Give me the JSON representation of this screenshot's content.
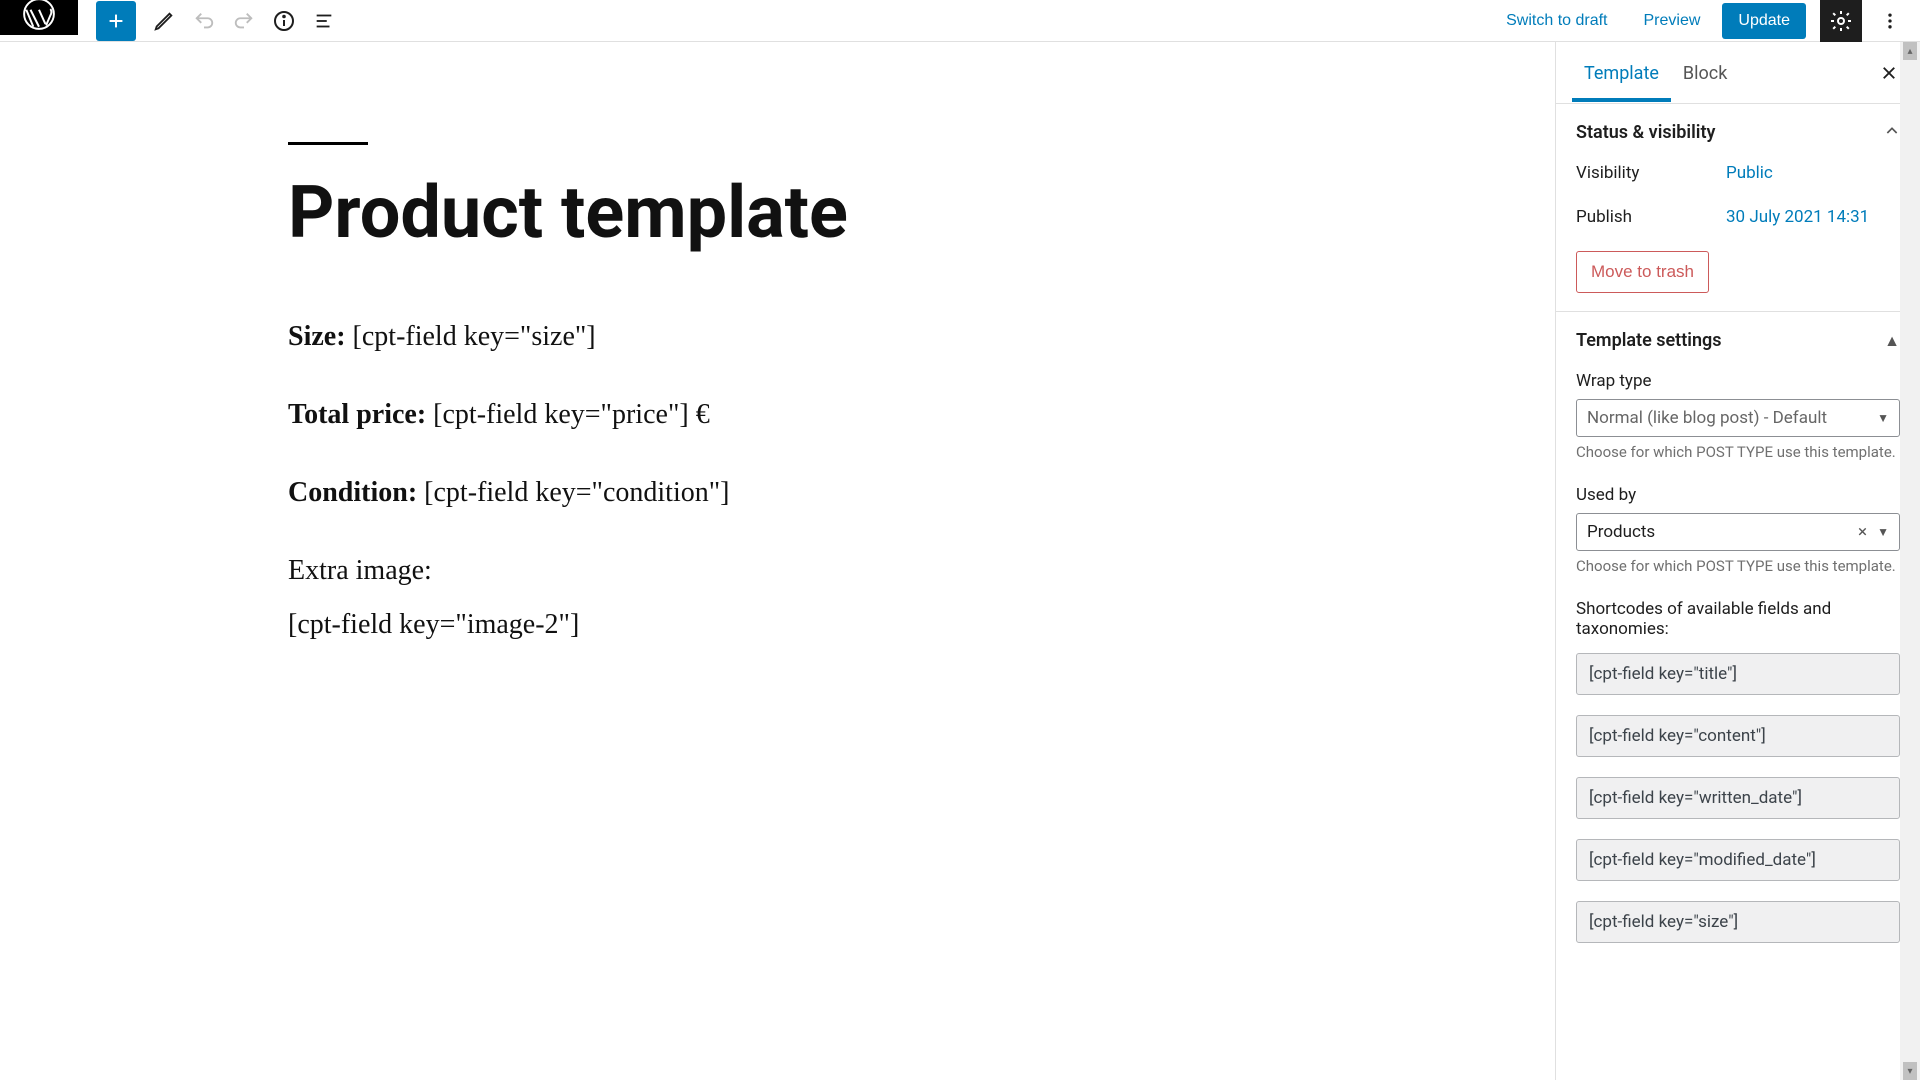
{
  "toolbar": {
    "switch_to_draft": "Switch to draft",
    "preview": "Preview",
    "update": "Update"
  },
  "tabs": {
    "template": "Template",
    "block": "Block"
  },
  "status_panel": {
    "title": "Status & visibility",
    "visibility_label": "Visibility",
    "visibility_value": "Public",
    "publish_label": "Publish",
    "publish_value": "30 July 2021 14:31",
    "trash": "Move to trash"
  },
  "template_settings": {
    "title": "Template settings",
    "wrap_label": "Wrap type",
    "wrap_value": "Normal (like blog post) - Default",
    "wrap_helper": "Choose for which POST TYPE use this template.",
    "used_by_label": "Used by",
    "used_by_value": "Products",
    "used_by_helper": "Choose for which POST TYPE use this template.",
    "shortcodes_label": "Shortcodes of available fields and taxonomies:",
    "shortcodes": [
      "[cpt-field key=\"title\"]",
      "[cpt-field key=\"content\"]",
      "[cpt-field key=\"written_date\"]",
      "[cpt-field key=\"modified_date\"]",
      "[cpt-field key=\"size\"]"
    ]
  },
  "post": {
    "title": "Product template",
    "size_label": "Size:",
    "size_value": " [cpt-field key=\"size\"]",
    "price_label": "Total price:",
    "price_value": " [cpt-field key=\"price\"] €",
    "condition_label": "Condition:",
    "condition_value": " [cpt-field key=\"condition\"]",
    "extra_image_label": "Extra image:",
    "extra_image_value": "[cpt-field key=\"image-2\"]"
  }
}
